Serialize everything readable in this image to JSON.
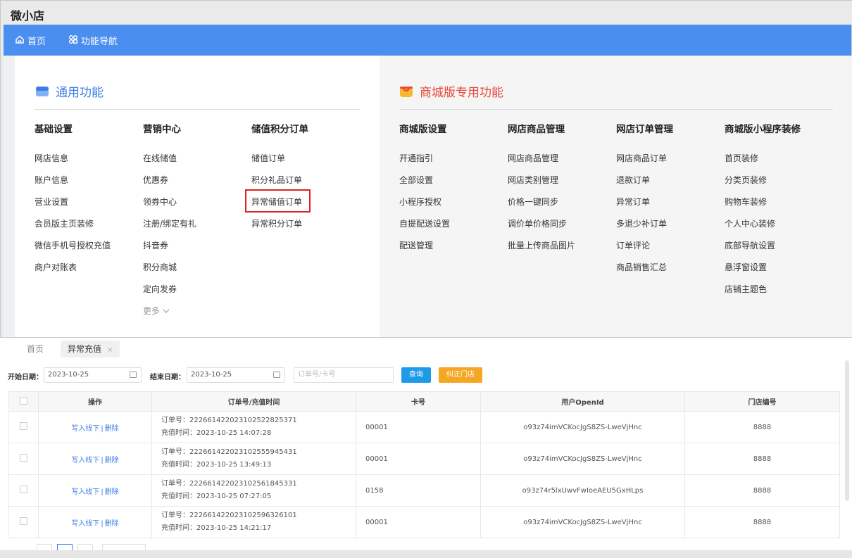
{
  "app": {
    "title": "微小店"
  },
  "nav": {
    "home": "首页",
    "functions": "功能导航"
  },
  "general": {
    "title": "通用功能",
    "columns": [
      {
        "head": "基础设置",
        "items": [
          "网店信息",
          "账户信息",
          "营业设置",
          "会员版主页装修",
          "微信手机号授权充值",
          "商户对账表"
        ]
      },
      {
        "head": "营销中心",
        "items": [
          "在线储值",
          "优惠券",
          "领券中心",
          "注册/绑定有礼",
          "抖音券",
          "积分商城",
          "定向发券"
        ],
        "more": "更多"
      },
      {
        "head": "储值积分订单",
        "items": [
          "储值订单",
          "积分礼品订单",
          "异常储值订单",
          "异常积分订单"
        ]
      }
    ]
  },
  "mall": {
    "title": "商城版专用功能",
    "columns": [
      {
        "head": "商城版设置",
        "items": [
          "开通指引",
          "全部设置",
          "小程序授权",
          "自提配送设置",
          "配送管理"
        ]
      },
      {
        "head": "网店商品管理",
        "items": [
          "网店商品管理",
          "网店类别管理",
          "价格一键同步",
          "调价单价格同步",
          "批量上传商品图片"
        ]
      },
      {
        "head": "网店订单管理",
        "items": [
          "网店商品订单",
          "退款订单",
          "异常订单",
          "多退少补订单",
          "订单评论",
          "商品销售汇总"
        ]
      },
      {
        "head": "商城版小程序装修",
        "items": [
          "首页装修",
          "分类页装修",
          "购物车装修",
          "个人中心装修",
          "底部导航设置",
          "悬浮窗设置",
          "店铺主题色"
        ]
      }
    ]
  },
  "tabs": {
    "home": "首页",
    "current": "异常充值",
    "close": "×"
  },
  "filters": {
    "start_label": "开始日期：",
    "start_value": "2023-10-25",
    "end_label": "结束日期：",
    "end_value": "2023-10-25",
    "search_placeholder": "订单号/卡号",
    "query_btn": "查询",
    "fix_btn": "纠正门店"
  },
  "table": {
    "headers": [
      "操作",
      "订单号/充值时间",
      "卡号",
      "用户OpenId",
      "门店编号"
    ],
    "op_write": "写入线下",
    "op_sep": "|",
    "op_delete": "删除",
    "rows": [
      {
        "order": "订单号：22266142202310252282537​1",
        "time": "充值时间：2023-10-25 14:07:28",
        "card": "00001",
        "openid": "o93z74imVCKocJgS8ZS-LweVjHnc",
        "store": "8888"
      },
      {
        "order": "订单号：22266142202310255594543​1",
        "time": "充值时间：2023-10-25 13:49:13",
        "card": "00001",
        "openid": "o93z74imVCKocJgS8ZS-LweVjHnc",
        "store": "8888"
      },
      {
        "order": "订单号：22266142202310256184533​1",
        "time": "充值时间：2023-10-25 07:27:05",
        "card": "0158",
        "openid": "o93z74r5lxUwvFwIoeAEU5GxHLps",
        "store": "8888"
      },
      {
        "order": "订单号：22266142202310259632610​1",
        "time": "充值时间：2023-10-25 14:21:17",
        "card": "00001",
        "openid": "o93z74imVCKocJgS8ZS-LweVjHnc",
        "store": "8888"
      }
    ]
  },
  "colors": {
    "nav_blue": "#4a8ef0",
    "link_blue": "#3b7de5",
    "query_btn": "#1e9be8",
    "fix_btn": "#f5a623",
    "highlight_red": "#e02020",
    "mall_title_red": "#e8473c"
  }
}
